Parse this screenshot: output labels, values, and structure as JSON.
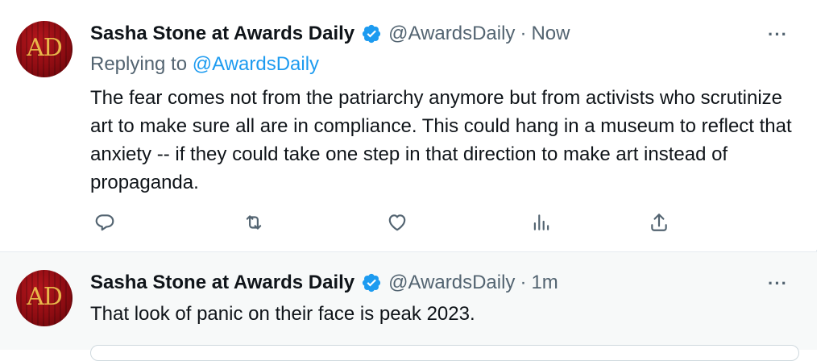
{
  "tweets": [
    {
      "avatar_letters": "AD",
      "name": "Sasha Stone at Awards Daily",
      "handle": "@AwardsDaily",
      "separator": "·",
      "time": "Now",
      "more": "···",
      "reply_prefix": "Replying to",
      "reply_mention": "@AwardsDaily",
      "text": "The fear comes not from the patriarchy anymore but from activists who scrutinize art to make sure all are in compliance. This could hang in a museum to reflect that anxiety -- if they could take one step in that direction to make art instead of propaganda."
    },
    {
      "avatar_letters": "AD",
      "name": "Sasha Stone at Awards Daily",
      "handle": "@AwardsDaily",
      "separator": "·",
      "time": "1m",
      "more": "···",
      "text": "That look of panic on their face is peak 2023."
    }
  ],
  "colors": {
    "accent": "#1d9bf0",
    "secondary_text": "#536471",
    "primary_text": "#0f1419",
    "avatar_red": "#8e0c12",
    "avatar_gold": "#e8b64a"
  },
  "icons": [
    "reply-icon",
    "retweet-icon",
    "like-icon",
    "views-icon",
    "share-icon",
    "verified-badge-icon",
    "more-icon"
  ]
}
